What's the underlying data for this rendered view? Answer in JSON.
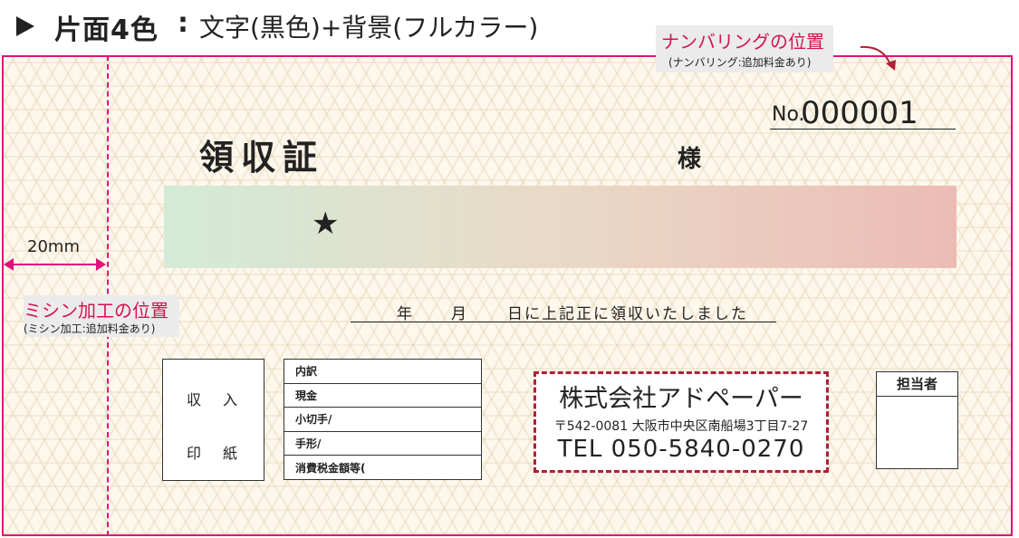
{
  "header": {
    "title": "片面4色",
    "colon": ":",
    "subtitle": "文字(黒色)+背景(フルカラー)"
  },
  "numbering": {
    "callout_title": "ナンバリングの位置",
    "callout_note": "(ナンバリング:追加料金あり)",
    "no_label": "No.",
    "no_value": "000001"
  },
  "receipt": {
    "title": "領収証",
    "honorific": "様",
    "amount_mark": "★",
    "date": {
      "year": "年",
      "month": "月",
      "rest": "日に上記正に領収いたしました"
    },
    "stamp": [
      "収",
      "入",
      "印",
      "紙"
    ],
    "breakdown": [
      "内訳",
      "現金",
      "小切手/",
      "手形/",
      "消費税金額等("
    ],
    "company": {
      "name": "株式会社アドペーパー",
      "address": "〒542-0081 大阪市中央区南船場3丁目7-27",
      "tel": "TEL 050-5840-0270"
    },
    "person_in_charge": "担当者"
  },
  "perforation": {
    "width_label": "20mm",
    "callout_title": "ミシン加工の位置",
    "callout_note": "(ミシン加工:追加料金あり)"
  },
  "colors": {
    "border_accent": "#e0137b",
    "callout_text": "#d5134f",
    "company_border": "#b41e34",
    "band_left": "#d3ebd6",
    "band_right": "#ecbcb4"
  }
}
